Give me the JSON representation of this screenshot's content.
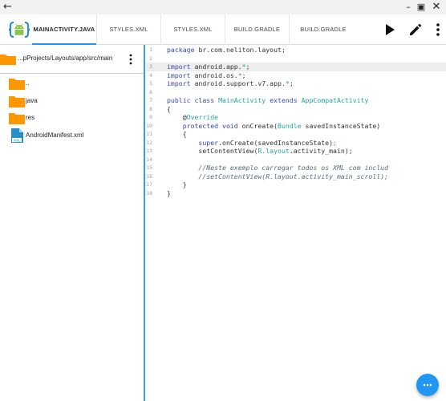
{
  "window": {
    "back_glyph": "←",
    "minimize_glyph": "–",
    "maximize_glyph": "▣",
    "close_glyph": "✕"
  },
  "toolbar": {
    "tabs": [
      {
        "label": "MAINACTIVITY.JAVA",
        "active": true
      },
      {
        "label": "STYLES.XML",
        "active": false
      },
      {
        "label": "STYLES.XML",
        "active": false
      },
      {
        "label": "BUILD.GRADLE",
        "active": false
      },
      {
        "label": "BUILD.GRADLE",
        "active": false
      }
    ],
    "actions": [
      "run-icon",
      "edit-icon",
      "more-vert-icon"
    ]
  },
  "sidebar": {
    "path": "...pProjects/Layouts/app/src/main",
    "items": [
      {
        "label": "..",
        "icon": "folder-icon"
      },
      {
        "label": "java",
        "icon": "folder-icon"
      },
      {
        "label": "res",
        "icon": "folder-icon"
      },
      {
        "label": "AndroidManifest.xml",
        "icon": "xml-file-icon"
      }
    ]
  },
  "editor": {
    "line_numbers": [
      "1",
      "2",
      "3",
      "4",
      "5",
      "6",
      "7",
      "8",
      "9",
      "10",
      "11",
      "12",
      "13",
      "14",
      "15",
      "16",
      "17",
      "18"
    ],
    "lines": [
      {
        "tokens": [
          {
            "t": "package",
            "c": "kw"
          },
          {
            "t": " br.com.neliton.layout;",
            "c": ""
          }
        ]
      },
      {
        "tokens": []
      },
      {
        "tokens": [
          {
            "t": "import",
            "c": "kw"
          },
          {
            "t": " android.app.",
            "c": ""
          },
          {
            "t": "*",
            "c": "ty"
          },
          {
            "t": ";",
            "c": ""
          }
        ]
      },
      {
        "tokens": [
          {
            "t": "import",
            "c": "kw"
          },
          {
            "t": " android.os.",
            "c": ""
          },
          {
            "t": "*",
            "c": "ty"
          },
          {
            "t": ";",
            "c": ""
          }
        ]
      },
      {
        "tokens": [
          {
            "t": "import",
            "c": "kw"
          },
          {
            "t": " android.support.v7.app.",
            "c": ""
          },
          {
            "t": "*",
            "c": "ty"
          },
          {
            "t": ";",
            "c": ""
          }
        ]
      },
      {
        "tokens": []
      },
      {
        "tokens": [
          {
            "t": "public class",
            "c": "kw"
          },
          {
            "t": " MainActivity ",
            "c": "ty"
          },
          {
            "t": "extends",
            "c": "kw"
          },
          {
            "t": " AppCompatActivity",
            "c": "ty"
          }
        ]
      },
      {
        "tokens": [
          {
            "t": "{",
            "c": ""
          }
        ]
      },
      {
        "tokens": [
          {
            "t": "    @",
            "c": ""
          },
          {
            "t": "Override",
            "c": "an"
          }
        ]
      },
      {
        "tokens": [
          {
            "t": "    protected",
            "c": "kw"
          },
          {
            "t": " void",
            "c": "kw"
          },
          {
            "t": " onCreate(",
            "c": ""
          },
          {
            "t": "Bundle",
            "c": "ty"
          },
          {
            "t": " savedInstanceState)",
            "c": ""
          }
        ]
      },
      {
        "tokens": [
          {
            "t": "    {",
            "c": ""
          }
        ]
      },
      {
        "tokens": [
          {
            "t": "        super",
            "c": "kw"
          },
          {
            "t": ".onCreate(savedInstanceState)",
            "c": ""
          },
          {
            "t": ";",
            "c": "ty"
          }
        ]
      },
      {
        "tokens": [
          {
            "t": "        setContentView(",
            "c": ""
          },
          {
            "t": "R.layout",
            "c": "ty"
          },
          {
            "t": ".activity_main);",
            "c": ""
          }
        ]
      },
      {
        "tokens": []
      },
      {
        "tokens": [
          {
            "t": "        //Neste exemplo carregar todos os XML com includ",
            "c": "cm"
          }
        ]
      },
      {
        "tokens": [
          {
            "t": "        //setContentView(R.layout.activity_main_scroll);",
            "c": "cm"
          }
        ]
      },
      {
        "tokens": [
          {
            "t": "    }",
            "c": ""
          }
        ]
      },
      {
        "tokens": [
          {
            "t": "}",
            "c": ""
          }
        ]
      }
    ],
    "highlighted_line": 3
  },
  "fab": {
    "icon": "more-horiz-icon"
  },
  "colors": {
    "accent": "#2196f3",
    "folder": "#ff9800",
    "keyword": "#3949ab",
    "type": "#26a69a",
    "comment": "#546e7a"
  }
}
